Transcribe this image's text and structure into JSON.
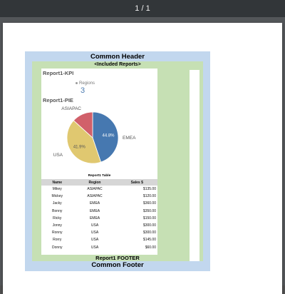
{
  "viewer": {
    "page_indicator": "1 / 1"
  },
  "document": {
    "common_header": "Common Header",
    "included_reports": "<Included Reports>",
    "common_footer": "Common Footer",
    "report": {
      "kpi_title": "Report1-KPI",
      "kpi_label": "Regions",
      "kpi_value": "3",
      "pie_title": "Report1-PIE",
      "table_title": "Report1 Table",
      "footer": "Report1 FOOTER",
      "table": {
        "headers": [
          "Name",
          "Region",
          "Sales $"
        ],
        "rows": [
          [
            "Mikey",
            "ASIAPAC",
            "$135.00"
          ],
          [
            "Mickey",
            "ASIAPAC",
            "$120.00"
          ],
          [
            "Jacky",
            "EMEA",
            "$360.00"
          ],
          [
            "Bonny",
            "EMEA",
            "$350.00"
          ],
          [
            "Ricky",
            "EMEA",
            "$150.00"
          ],
          [
            "Jonny",
            "USA",
            "$300.00"
          ],
          [
            "Ronny",
            "USA",
            "$300.00"
          ],
          [
            "Rorry",
            "USA",
            "$145.00"
          ],
          [
            "Donny",
            "USA",
            "$60.00"
          ]
        ]
      }
    }
  },
  "chart_data": {
    "type": "pie",
    "title": "Report1-PIE",
    "categories": [
      "EMEA",
      "USA",
      "ASIAPAC"
    ],
    "values": [
      44.8,
      41.9,
      13.3
    ],
    "value_labels": [
      "44.8%",
      "41.9%",
      ""
    ],
    "colors": [
      "#4678b0",
      "#e0c870",
      "#d1606a"
    ]
  }
}
